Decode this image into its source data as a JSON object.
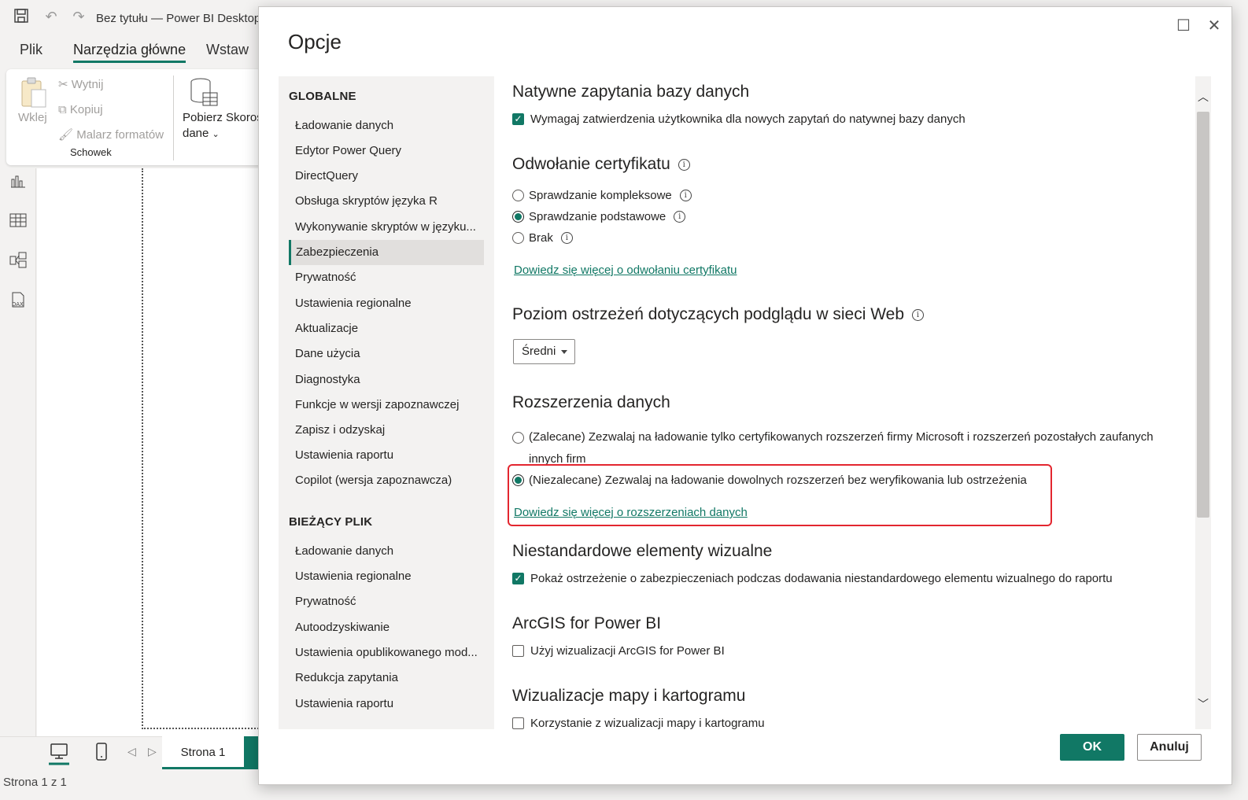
{
  "app": {
    "window_title": "Bez tytułu — Power BI Desktop",
    "ribbon_tabs": [
      "Plik",
      "Narzędzia główne",
      "Wstaw"
    ],
    "ribbon": {
      "paste": "Wklej",
      "cut": "Wytnij",
      "copy": "Kopiuj",
      "format_painter": "Malarz formatów",
      "clipboard_group": "Schowek",
      "get_data_line1": "Pobierz",
      "get_data_line2": "dane",
      "get_data_partial": "Skoros"
    },
    "page_tab": "Strona 1",
    "status": "Strona 1 z 1"
  },
  "dialog": {
    "title": "Opcje",
    "nav": {
      "global_header": "GLOBALNE",
      "global_items": [
        "Ładowanie danych",
        "Edytor Power Query",
        "DirectQuery",
        "Obsługa skryptów języka R",
        "Wykonywanie skryptów w języku...",
        "Zabezpieczenia",
        "Prywatność",
        "Ustawienia regionalne",
        "Aktualizacje",
        "Dane użycia",
        "Diagnostyka",
        "Funkcje w wersji zapoznawczej",
        "Zapisz i odzyskaj",
        "Ustawienia raportu",
        "Copilot (wersja zapoznawcza)"
      ],
      "current_header": "BIEŻĄCY PLIK",
      "current_items": [
        "Ładowanie danych",
        "Ustawienia regionalne",
        "Prywatność",
        "Autoodzyskiwanie",
        "Ustawienia opublikowanego mod...",
        "Redukcja zapytania",
        "Ustawienia raportu"
      ]
    },
    "sections": {
      "native_queries": {
        "title": "Natywne zapytania bazy danych",
        "checkbox": "Wymagaj zatwierdzenia użytkownika dla nowych zapytań do natywnej bazy danych"
      },
      "cert_revocation": {
        "title": "Odwołanie certyfikatu",
        "options": [
          "Sprawdzanie kompleksowe",
          "Sprawdzanie podstawowe",
          "Brak"
        ],
        "link": "Dowiedz się więcej o odwołaniu certyfikatu"
      },
      "web_preview": {
        "title": "Poziom ostrzeżeń dotyczących podglądu w sieci Web",
        "selected": "Średni"
      },
      "data_extensions": {
        "title": "Rozszerzenia danych",
        "option_recommended": "(Zalecane) Zezwalaj na ładowanie tylko certyfikowanych rozszerzeń firmy Microsoft i rozszerzeń pozostałych zaufanych innych firm",
        "option_not_recommended": "(Niezalecane) Zezwalaj na ładowanie dowolnych rozszerzeń bez weryfikowania lub ostrzeżenia",
        "link": "Dowiedz się więcej o rozszerzeniach danych"
      },
      "custom_visuals": {
        "title": "Niestandardowe elementy wizualne",
        "checkbox": "Pokaż ostrzeżenie o zabezpieczeniach podczas dodawania niestandardowego elementu wizualnego do raportu"
      },
      "arcgis": {
        "title": "ArcGIS for Power BI",
        "checkbox": "Użyj wizualizacji ArcGIS for Power BI"
      },
      "maps": {
        "title": "Wizualizacje mapy i kartogramu",
        "checkbox": "Korzystanie z wizualizacji mapy i kartogramu"
      }
    },
    "ok": "OK",
    "cancel": "Anuluj"
  },
  "colors": {
    "accent": "#117865",
    "highlight": "#e3262f"
  }
}
